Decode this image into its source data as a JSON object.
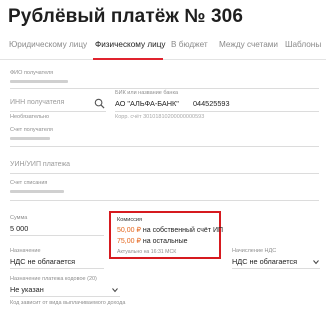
{
  "page": {
    "title": "Рублёвый платёж № 306"
  },
  "tabs": [
    {
      "label": "Юридическому лицу",
      "active": false
    },
    {
      "label": "Физическому лицу",
      "active": true
    },
    {
      "label": "В бюджет",
      "active": false
    },
    {
      "label": "Между счетами",
      "active": false
    },
    {
      "label": "Шаблоны",
      "active": false
    }
  ],
  "form": {
    "fio": {
      "label": "ФИО получателя"
    },
    "inn": {
      "placeholder": "ИНН получателя",
      "hint": "Необязательно"
    },
    "bik": {
      "label": "БИК или название банка",
      "bank_name": "АО \"АЛЬФА-БАНК\"",
      "bik": "044525593",
      "corr_account": "Корр. счёт 30101810200000000593"
    },
    "account": {
      "label": "Счет получателя"
    },
    "uin": {
      "placeholder": "УИН/УИП платежа"
    },
    "debit_account": {
      "label": "Счет списания"
    },
    "amount": {
      "label": "Сумма",
      "value": "5 000"
    },
    "purpose": {
      "label": "Назначение",
      "value": "НДС не облагается"
    },
    "vat": {
      "label": "Начисление НДС",
      "value": "НДС не облагается"
    },
    "payment_code": {
      "label": "Назначение платежа кодовое (20)",
      "value": "Не указан"
    },
    "footnote": "Код зависит от вида выплачиваемого дохода"
  },
  "commission": {
    "label": "Комиссия",
    "own_amount": "50,00 ₽",
    "own_text": "на собственный счёт ИП",
    "other_amount": "75,00 ₽",
    "other_text": "на остальные",
    "note": "Актуально на 16:31 МСК",
    "border_color": "#d61a1f"
  },
  "colors": {
    "accent": "#e0232e"
  }
}
